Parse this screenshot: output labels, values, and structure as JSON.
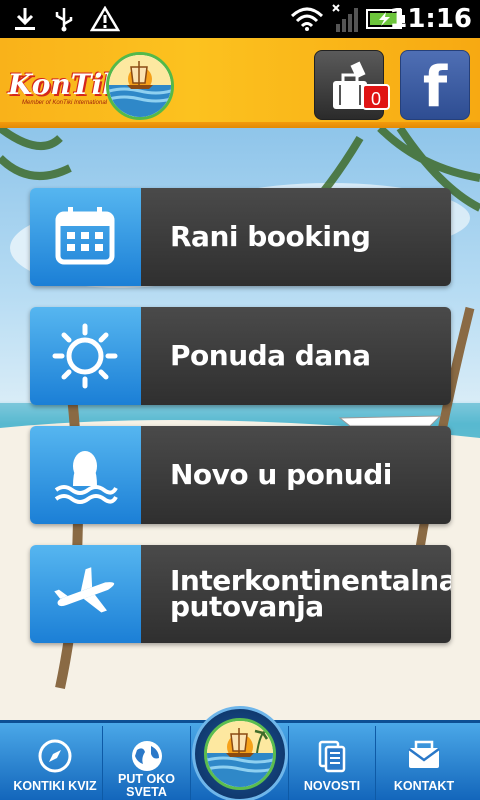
{
  "status_bar": {
    "time": "11:16",
    "icons": [
      "download-icon",
      "usb-icon",
      "warning-icon",
      "wifi-icon",
      "signal-icon",
      "battery-charging-icon"
    ]
  },
  "header": {
    "logo_text": "KonTiki",
    "logo_subtext": "Member of KonTiki International",
    "cart_badge": "0",
    "facebook_label": "f"
  },
  "menu": [
    {
      "label": "Rani booking",
      "icon": "calendar-icon"
    },
    {
      "label": "Ponuda dana",
      "icon": "sun-icon"
    },
    {
      "label": "Novo u ponudi",
      "icon": "swimmer-icon"
    },
    {
      "label_line1": "Interkontinentalna",
      "label_line2": "putovanja",
      "icon": "airplane-icon"
    }
  ],
  "bottom_nav": {
    "kviz": "KONTIKI KVIZ",
    "put_line1": "PUT OKO",
    "put_line2": "SVETA",
    "novosti": "NOVOSTI",
    "kontakt": "KONTAKT"
  },
  "colors": {
    "header": "#fcc21f",
    "menu_icon_bg": "#1b7fd6",
    "menu_label_bg": "#3a3a3a",
    "nav": "#1f7bd0"
  }
}
